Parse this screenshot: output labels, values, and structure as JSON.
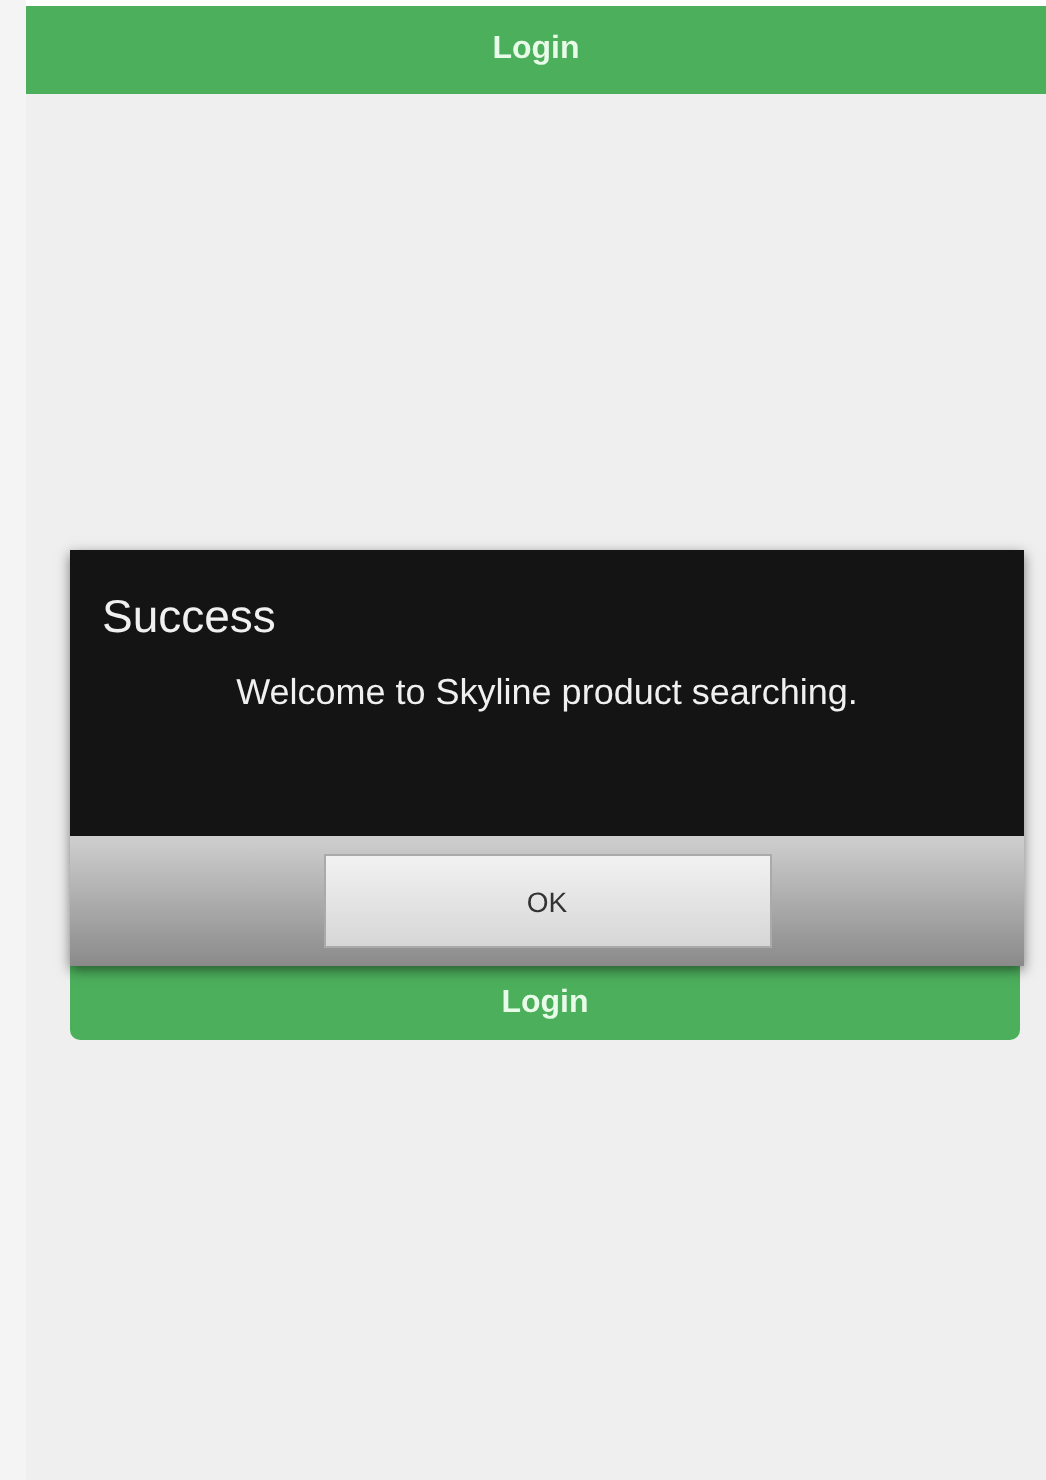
{
  "header": {
    "title": "Login"
  },
  "login_button": {
    "label": "Login"
  },
  "dialog": {
    "title": "Success",
    "message": "Welcome to Skyline product searching.",
    "button": "OK"
  }
}
